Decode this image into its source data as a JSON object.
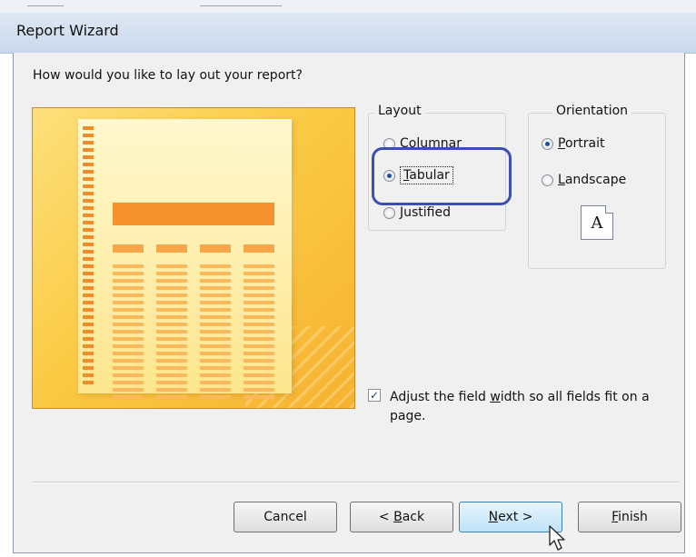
{
  "window": {
    "title": "Report Wizard"
  },
  "question": "How would you like to lay out your report?",
  "layout": {
    "legend": "Layout",
    "options": [
      {
        "key": "C",
        "rest": "olumnar",
        "selected": false
      },
      {
        "key": "T",
        "rest": "abular",
        "selected": true
      },
      {
        "key": "J",
        "rest": "ustified",
        "selected": false
      }
    ]
  },
  "orientation": {
    "legend": "Orientation",
    "options": [
      {
        "key": "P",
        "rest": "ortrait",
        "selected": true
      },
      {
        "key": "L",
        "rest": "andscape",
        "selected": false
      }
    ],
    "icon_letter": "A"
  },
  "adjust": {
    "checked": true,
    "text_before": "Adjust the field ",
    "text_key": "w",
    "text_after": "idth so all fields fit on a page."
  },
  "buttons": {
    "cancel": "Cancel",
    "back_prefix": "< ",
    "back_key": "B",
    "back_rest": "ack",
    "next_key": "N",
    "next_rest": "ext >",
    "finish_key": "F",
    "finish_rest": "inish"
  },
  "icons": {
    "preview": "tabular-report-preview-icon",
    "orientation": "portrait-page-icon",
    "cursor": "mouse-pointer-icon"
  },
  "colors": {
    "selection_highlight": "#3a4fb0",
    "preview_accent": "#f4932e",
    "hover_button": "#bfe3f8"
  }
}
